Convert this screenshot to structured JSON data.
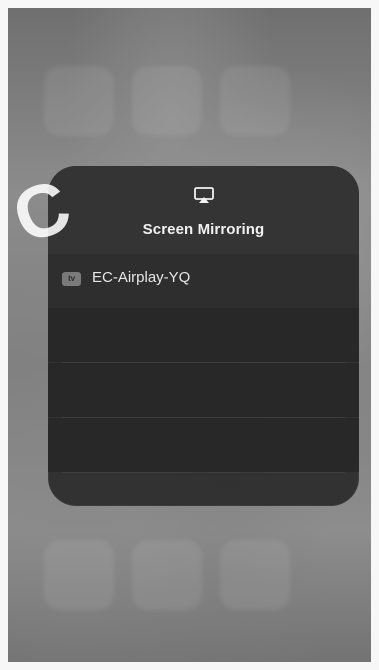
{
  "panel": {
    "title": "Screen Mirroring",
    "device": {
      "name": "EC-Airplay-YQ",
      "badge": "tv"
    }
  },
  "watermark": {
    "text": "C"
  },
  "colors": {
    "panel_background": "#2b2b2b",
    "device_text": "#e7e7e7",
    "title_text": "#f1f1f1"
  },
  "icons": {
    "airplay": "airplay-icon",
    "device": "appletv-icon"
  }
}
